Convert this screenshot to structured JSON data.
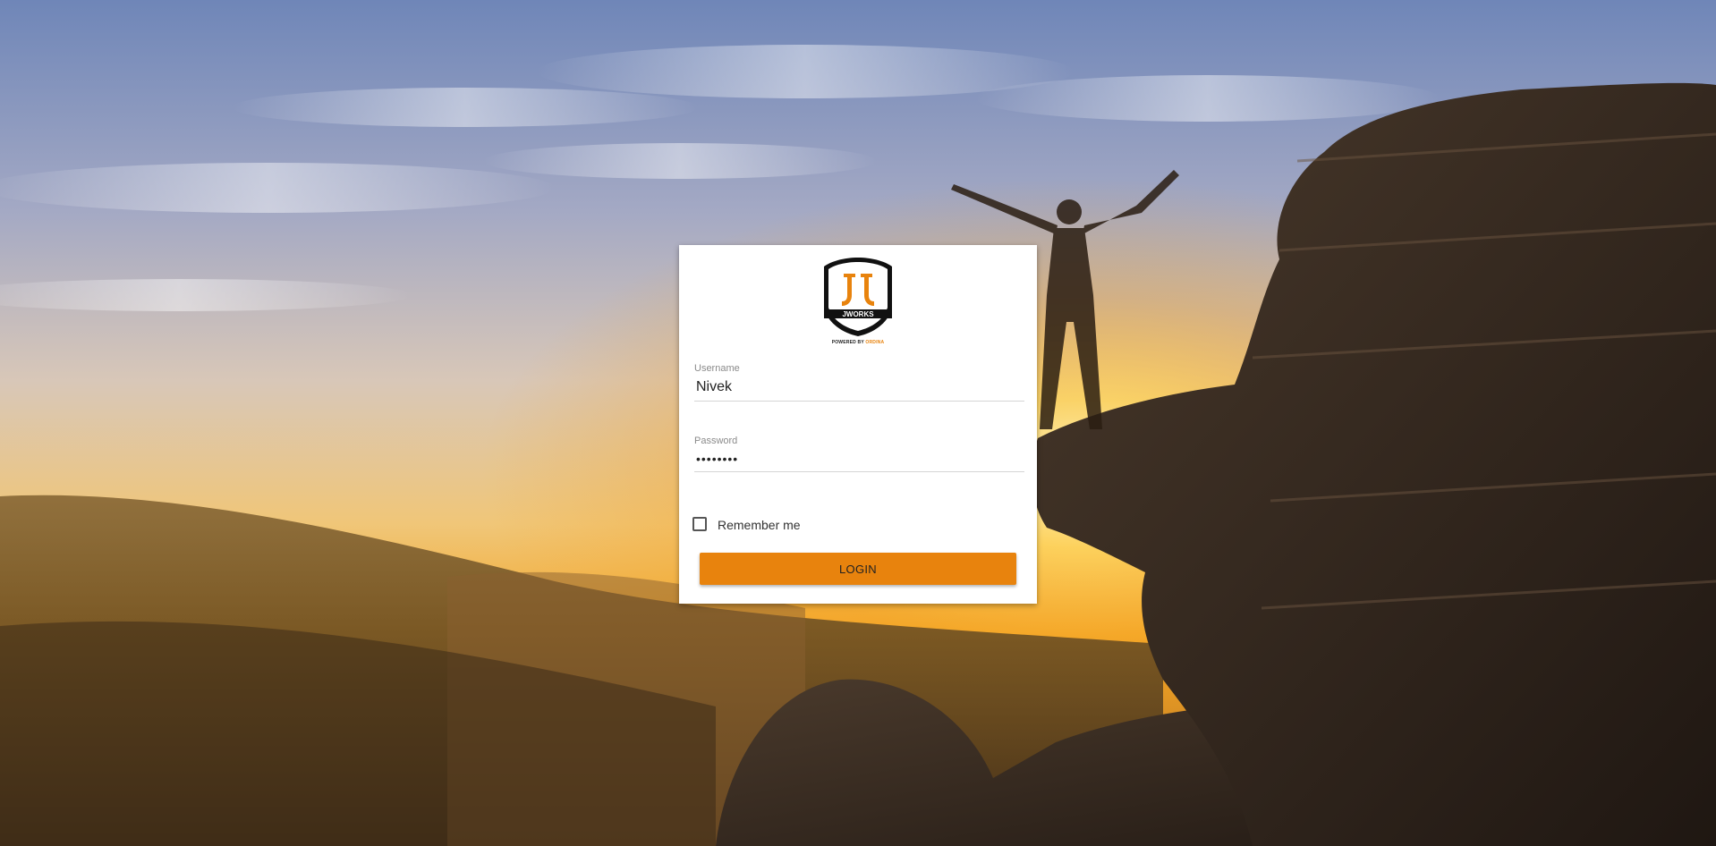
{
  "background": {
    "description_icon": "mountain-sunrise-scene"
  },
  "logo": {
    "brand_text": "JWORKS",
    "powered_by_prefix": "POWERED BY",
    "powered_by_brand": "ORDINA"
  },
  "form": {
    "username": {
      "label": "Username",
      "value": "Nivek"
    },
    "password": {
      "label": "Password",
      "value": "••••••••"
    },
    "remember_me": {
      "label": "Remember me",
      "checked": false
    },
    "login_button_label": "LOGIN"
  },
  "colors": {
    "accent": "#e8830d",
    "card_background": "#ffffff"
  }
}
